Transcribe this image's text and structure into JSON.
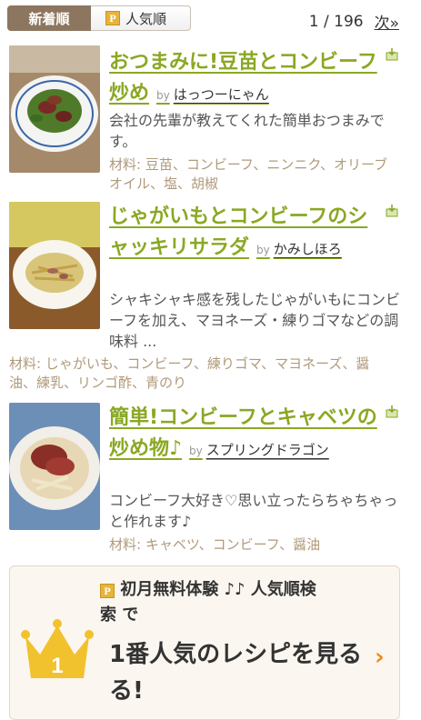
{
  "tabs": {
    "new_label": "新着順",
    "popular_label": "人気順",
    "popular_badge": "P"
  },
  "pager": {
    "text": "1 / 196",
    "next": "次»"
  },
  "recipes": [
    {
      "title": "おつまみに!豆苗とコンビーフ炒め",
      "by": "by",
      "author": "はっつーにゃん",
      "description": "会社の先輩が教えてくれた簡単おつまみです。",
      "ingredients": "材料: 豆苗、コンビーフ、ニンニク、オリーブオイル、塩、胡椒"
    },
    {
      "title": "じゃがいもとコンビーフのシャッキリサラダ",
      "by": "by",
      "author": "かみしほろ",
      "description": "シャキシャキ感を残したじゃがいもにコンビーフを加え、マヨネーズ・練りゴマなどの調味料 ...",
      "ingredients": "材料: じゃがいも、コンビーフ、練りゴマ、マヨネーズ、醤油、練乳、リンゴ酢、青のり"
    },
    {
      "title": "簡単!コンビーフとキャベツの炒め物♪",
      "by": "by",
      "author": "スプリングドラゴン",
      "description": "コンビーフ大好き♡思い立ったらちゃちゃっと作れます♪",
      "ingredients": "材料: キャベツ、コンビーフ、醤油"
    }
  ],
  "promo": {
    "badge": "P",
    "headline_line1": "初月無料体験 ♪♪ 人気順検",
    "headline_line2": "索 で",
    "main_line1": "1番人気のレシピを見る",
    "main_line2": "る!",
    "crown_number": "1",
    "arrow": "›"
  },
  "colors": {
    "title_green": "#8aa823",
    "tab_brown": "#8c7660",
    "ingredient_tan": "#b09a7a",
    "crown_gold": "#f2c12e",
    "arrow_orange": "#f18a1c"
  }
}
